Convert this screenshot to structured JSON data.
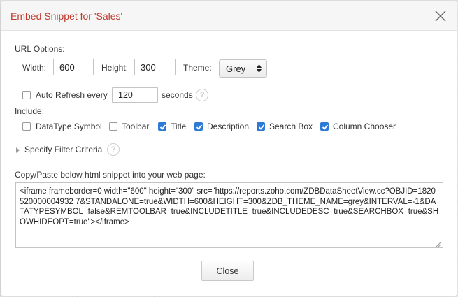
{
  "dialog": {
    "title": "Embed Snippet for 'Sales'"
  },
  "url_options": {
    "heading": "URL Options:",
    "width_label": "Width:",
    "width_value": "600",
    "height_label": "Height:",
    "height_value": "300",
    "theme_label": "Theme:",
    "theme_value": "Grey"
  },
  "auto_refresh": {
    "label": "Auto Refresh every",
    "checked": false,
    "value": "120",
    "unit": "seconds",
    "help": "?"
  },
  "include": {
    "heading": "Include:",
    "options": [
      {
        "label": "DataType Symbol",
        "checked": false
      },
      {
        "label": "Toolbar",
        "checked": false
      },
      {
        "label": "Title",
        "checked": true
      },
      {
        "label": "Description",
        "checked": true
      },
      {
        "label": "Search Box",
        "checked": true
      },
      {
        "label": "Column Chooser",
        "checked": true
      }
    ]
  },
  "filter": {
    "label": "Specify Filter Criteria",
    "help": "?"
  },
  "snippet": {
    "label": "Copy/Paste below html snippet into your web page:",
    "code": "<iframe frameborder=0 width=\"600\" height=\"300\" src=\"https://reports.zoho.com/ZDBDataSheetView.cc?OBJID=1820520000004932 7&STANDALONE=true&WIDTH=600&HEIGHT=300&ZDB_THEME_NAME=grey&INTERVAL=-1&DATATYPESYMBOL=false&REMTOOLBAR=true&INCLUDETITLE=true&INCLUDEDESC=true&SEARCHBOX=true&SHOWHIDEOPT=true\"></iframe>"
  },
  "footer": {
    "close_label": "Close"
  },
  "colors": {
    "title": "#c0392b",
    "checkbox_checked": "#2d7ad6"
  }
}
